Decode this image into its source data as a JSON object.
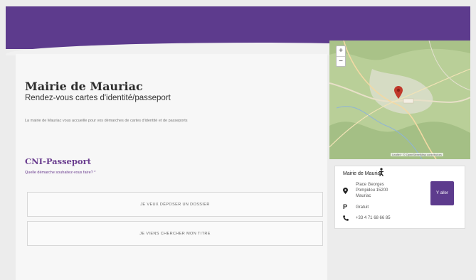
{
  "header": {
    "title": "Mairie de Mauriac",
    "subtitle": "Rendez-vous cartes d'identité/passeport",
    "intro": "La mairie de Mauriac vous accueille pour vos démarches de cartes d'identité et de passeports"
  },
  "section": {
    "title": "CNI-Passeport",
    "question": "Quelle démarche souhaitez-vous faire? *"
  },
  "choices": [
    "JE VEUX DÉPOSER UN DOSSIER",
    "JE VIENS CHERCHER MON TITRE"
  ],
  "map": {
    "zoom_in": "+",
    "zoom_out": "−",
    "attribution": "Leaflet · © OpenStreetMap contributors"
  },
  "location": {
    "name": "Mairie de Mauriac",
    "address": "Place Georges Pompidou 15200 Mauriac",
    "parking": "Gratuit",
    "phone": "+33 4 71 68 66 85",
    "choose_label": "Y aller"
  },
  "icons": {
    "accessibility": "person-icon",
    "address": "map-pin-icon",
    "parking": "parking-icon",
    "phone": "phone-icon",
    "map_marker": "map-marker-icon"
  },
  "colors": {
    "brand": "#5d3b8d",
    "accent": "#6a3d8f",
    "marker": "#c0392b"
  }
}
